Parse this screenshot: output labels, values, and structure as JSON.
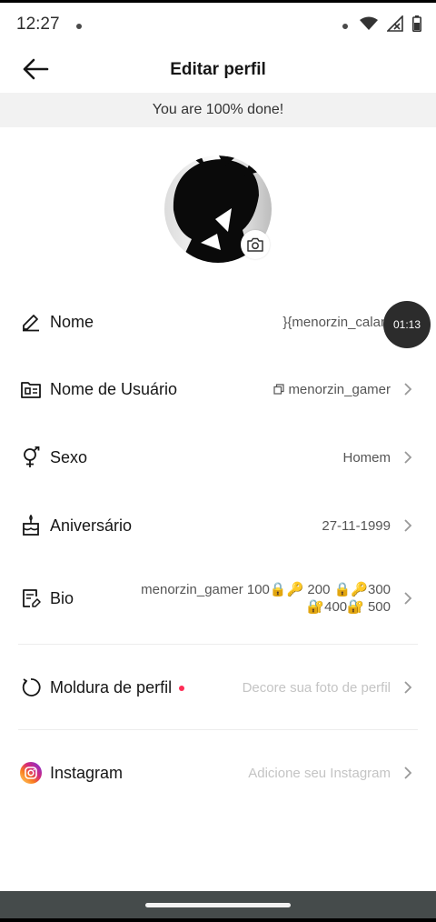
{
  "status_bar": {
    "time": "12:27"
  },
  "header": {
    "title": "Editar perfil"
  },
  "banner": {
    "text": "You are 100% done!"
  },
  "rows": {
    "nome": {
      "label": "Nome",
      "value": "}{menorzin_calango}{"
    },
    "username": {
      "label": "Nome de Usuário",
      "value": "menorzin_gamer"
    },
    "sexo": {
      "label": "Sexo",
      "value": "Homem"
    },
    "aniversario": {
      "label": "Aniversário",
      "value": "27-11-1999"
    },
    "bio": {
      "label": "Bio",
      "value_line1": "menorzin_gamer 100🔒🔑 200 🔒🔑300",
      "value_line2": "🔐400🔐 500"
    },
    "moldura": {
      "label": "Moldura de perfil",
      "value": "Decore sua foto de perfil"
    },
    "instagram": {
      "label": "Instagram",
      "value": "Adicione seu Instagram"
    }
  },
  "overlay": {
    "timer": "01:13"
  },
  "colors": {
    "accent_red": "#fe2c55",
    "placeholder": "#c4c4c4"
  }
}
